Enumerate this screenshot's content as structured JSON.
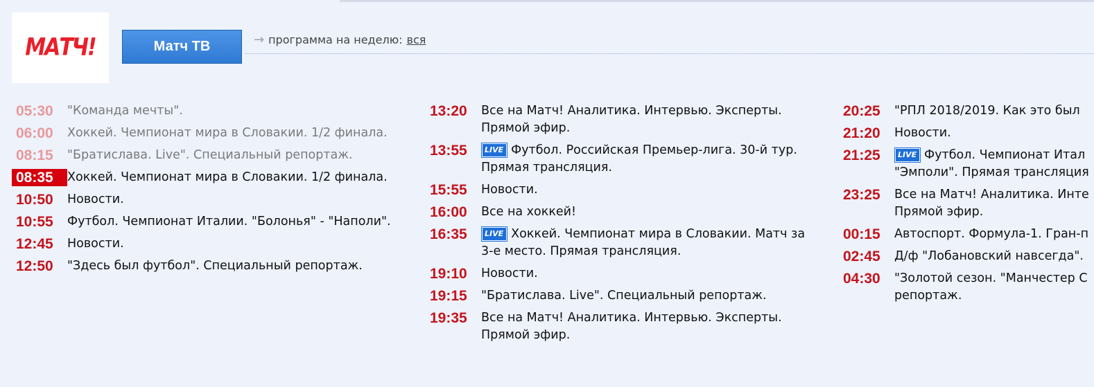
{
  "logo": {
    "text": "МАТЧ!"
  },
  "channel_button": "Матч ТВ",
  "week_nav": {
    "arrow": "→",
    "label": "программа на неделю:",
    "link": "вся"
  },
  "live_badge": "LIVE",
  "columns": [
    [
      {
        "time": "05:30",
        "title": "\"Команда мечты\".",
        "status": "past"
      },
      {
        "time": "06:00",
        "title": "Хоккей. Чемпионат мира в Словакии. 1/2 финала.",
        "status": "past"
      },
      {
        "time": "08:15",
        "title": "\"Братислава. Live\". Специальный репортаж.",
        "status": "past"
      },
      {
        "time": "08:35",
        "title": "Хоккей. Чемпионат мира в Словакии. 1/2 финала.",
        "status": "current"
      },
      {
        "time": "10:50",
        "title": "Новости."
      },
      {
        "time": "10:55",
        "title": "Футбол. Чемпионат Италии. \"Болонья\" - \"Наполи\"."
      },
      {
        "time": "12:45",
        "title": "Новости."
      },
      {
        "time": "12:50",
        "title": "\"Здесь был футбол\". Специальный репортаж."
      }
    ],
    [
      {
        "time": "13:20",
        "title": "Все на Матч! Аналитика. Интервью. Эксперты. Прямой эфир."
      },
      {
        "time": "13:55",
        "title": "Футбол. Российская Премьер-лига. 30-й тур. Прямая трансляция.",
        "live": true
      },
      {
        "time": "15:55",
        "title": "Новости."
      },
      {
        "time": "16:00",
        "title": "Все на хоккей!"
      },
      {
        "time": "16:35",
        "title": "Хоккей. Чемпионат мира в Словакии. Матч за 3-е место. Прямая трансляция.",
        "live": true
      },
      {
        "time": "19:10",
        "title": "Новости."
      },
      {
        "time": "19:15",
        "title": "\"Братислава. Live\". Специальный репортаж."
      },
      {
        "time": "19:35",
        "title": "Все на Матч! Аналитика. Интервью. Эксперты. Прямой эфир."
      }
    ],
    [
      {
        "time": "20:25",
        "title": "\"РПЛ 2018/2019. Как это был"
      },
      {
        "time": "21:20",
        "title": "Новости."
      },
      {
        "time": "21:25",
        "title": "Футбол. Чемпионат Итал",
        "title2": "\"Эмполи\". Прямая трансляция",
        "live": true
      },
      {
        "time": "23:25",
        "title": "Все на Матч! Аналитика. Инте",
        "title2": "Прямой эфир."
      },
      {
        "time": "00:15",
        "title": "Автоспорт. Формула-1. Гран-п"
      },
      {
        "time": "02:45",
        "title": "Д/ф \"Лобановский навсегда\"."
      },
      {
        "time": "04:30",
        "title": "\"Золотой сезон. \"Манчестер С",
        "title2": "репортаж."
      }
    ]
  ]
}
